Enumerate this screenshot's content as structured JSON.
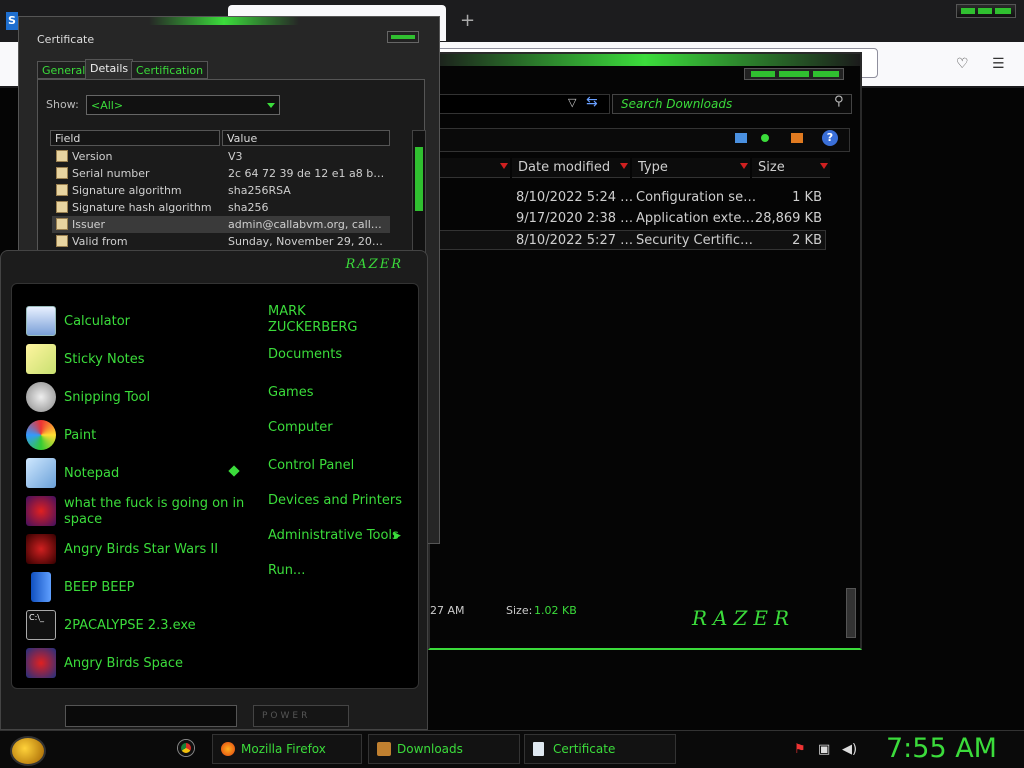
{
  "firefox": {
    "logo": "S",
    "new_tab": "+"
  },
  "explorer": {
    "search_placeholder": "Search Downloads",
    "columns": [
      "Date modified",
      "Type",
      "Size"
    ],
    "rows": [
      {
        "date": "8/10/2022 5:24 …",
        "type": "Configuration se…",
        "size": "1 KB"
      },
      {
        "date": "9/17/2020 2:38 …",
        "type": "Application exte…",
        "size": "28,869 KB"
      },
      {
        "date": "8/10/2022 5:27 …",
        "type": "Security Certific…",
        "size": "2 KB"
      }
    ],
    "status_time": "27 AM",
    "status_size_label": "Size:",
    "status_size_value": "1.02 KB",
    "brand": "RAZER"
  },
  "certificate": {
    "title": "Certificate",
    "tabs": [
      "General",
      "Details",
      "Certification Path"
    ],
    "show_label": "Show:",
    "show_value": "<All>",
    "headers": {
      "field": "Field",
      "value": "Value"
    },
    "rows": [
      {
        "field": "Version",
        "value": "V3"
      },
      {
        "field": "Serial number",
        "value": "2c 64 72 39 de 12 e1 a8 bc 22..."
      },
      {
        "field": "Signature algorithm",
        "value": "sha256RSA"
      },
      {
        "field": "Signature hash algorithm",
        "value": "sha256"
      },
      {
        "field": "Issuer",
        "value": "admin@callabvm.org, callabne ..."
      },
      {
        "field": "Valid from",
        "value": "Sunday, November 29, 2020 ..."
      }
    ]
  },
  "start_menu": {
    "brand": "RAZER",
    "programs": [
      {
        "label": "Calculator",
        "icon": "calculator-icon"
      },
      {
        "label": "Sticky Notes",
        "icon": "sticky-notes-icon"
      },
      {
        "label": "Snipping Tool",
        "icon": "scissors-icon"
      },
      {
        "label": "Paint",
        "icon": "palette-icon"
      },
      {
        "label": "Notepad",
        "icon": "notepad-icon"
      },
      {
        "label": "what the fuck is going on in space",
        "icon": "angry-birds-space-icon"
      },
      {
        "label": "Angry Birds Star Wars II",
        "icon": "angry-birds-starwars-icon"
      },
      {
        "label": "BEEP BEEP",
        "icon": "blue-phone-icon"
      },
      {
        "label": "2PACALYPSE 2.3.exe",
        "icon": "console-icon"
      },
      {
        "label": "Angry Birds Space",
        "icon": "angry-birds-space-icon"
      }
    ],
    "places": [
      "MARK ZUCKERBERG",
      "Documents",
      "Games",
      "Computer",
      "Control Panel",
      "Devices and Printers",
      "Administrative Tools",
      "Run..."
    ],
    "power_label": "POWER"
  },
  "taskbar": {
    "buttons": [
      "Mozilla Firefox",
      "Downloads",
      "Certificate"
    ],
    "clock": "7:55 AM"
  }
}
